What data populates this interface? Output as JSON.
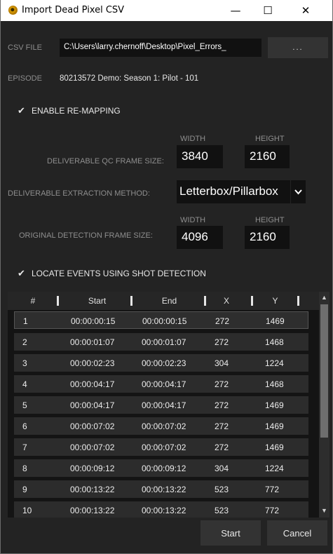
{
  "window": {
    "title": "Import Dead Pixel CSV",
    "minimize_glyph": "—",
    "maximize_glyph": "☐",
    "close_glyph": "✕"
  },
  "csv": {
    "label": "CSV FILE",
    "path": "C:\\Users\\larry.chernoff\\Desktop\\Pixel_Errors_",
    "browse_label": "..."
  },
  "episode": {
    "label": "EPISODE",
    "value": "80213572  Demo: Season 1: Pilot - 101"
  },
  "remap": {
    "checkbox_label": "ENABLE RE-MAPPING",
    "checked": true,
    "width_header": "WIDTH",
    "height_header": "HEIGHT",
    "qc_label": "DELIVERABLE QC FRAME SIZE:",
    "qc_width": "3840",
    "qc_height": "2160",
    "method_label": "DELIVERABLE EXTRACTION METHOD:",
    "method_value": "Letterbox/Pillarbox",
    "orig_label": "ORIGINAL DETECTION FRAME SIZE:",
    "orig_width": "4096",
    "orig_height": "2160"
  },
  "shot_detection": {
    "checkbox_label": "LOCATE EVENTS USING SHOT DETECTION",
    "checked": true
  },
  "table": {
    "columns": [
      "#",
      "Start",
      "End",
      "X",
      "Y"
    ],
    "rows": [
      [
        "1",
        "00:00:00:15",
        "00:00:00:15",
        "272",
        "1469"
      ],
      [
        "2",
        "00:00:01:07",
        "00:00:01:07",
        "272",
        "1468"
      ],
      [
        "3",
        "00:00:02:23",
        "00:00:02:23",
        "304",
        "1224"
      ],
      [
        "4",
        "00:00:04:17",
        "00:00:04:17",
        "272",
        "1468"
      ],
      [
        "5",
        "00:00:04:17",
        "00:00:04:17",
        "272",
        "1469"
      ],
      [
        "6",
        "00:00:07:02",
        "00:00:07:02",
        "272",
        "1469"
      ],
      [
        "7",
        "00:00:07:02",
        "00:00:07:02",
        "272",
        "1469"
      ],
      [
        "8",
        "00:00:09:12",
        "00:00:09:12",
        "304",
        "1224"
      ],
      [
        "9",
        "00:00:13:22",
        "00:00:13:22",
        "523",
        "772"
      ],
      [
        "10",
        "00:00:13:22",
        "00:00:13:22",
        "523",
        "772"
      ]
    ],
    "selected_row": 0
  },
  "buttons": {
    "start": "Start",
    "cancel": "Cancel"
  },
  "icons": {
    "app": "app-icon",
    "checkmark": "✔",
    "dropdown": "chevron-down-icon",
    "scroll_up": "▲",
    "scroll_down": "▼"
  },
  "colors": {
    "background": "#232323",
    "field": "#111111",
    "button": "#333333",
    "row": "#2c2c2c",
    "label": "#8e8e8e"
  }
}
